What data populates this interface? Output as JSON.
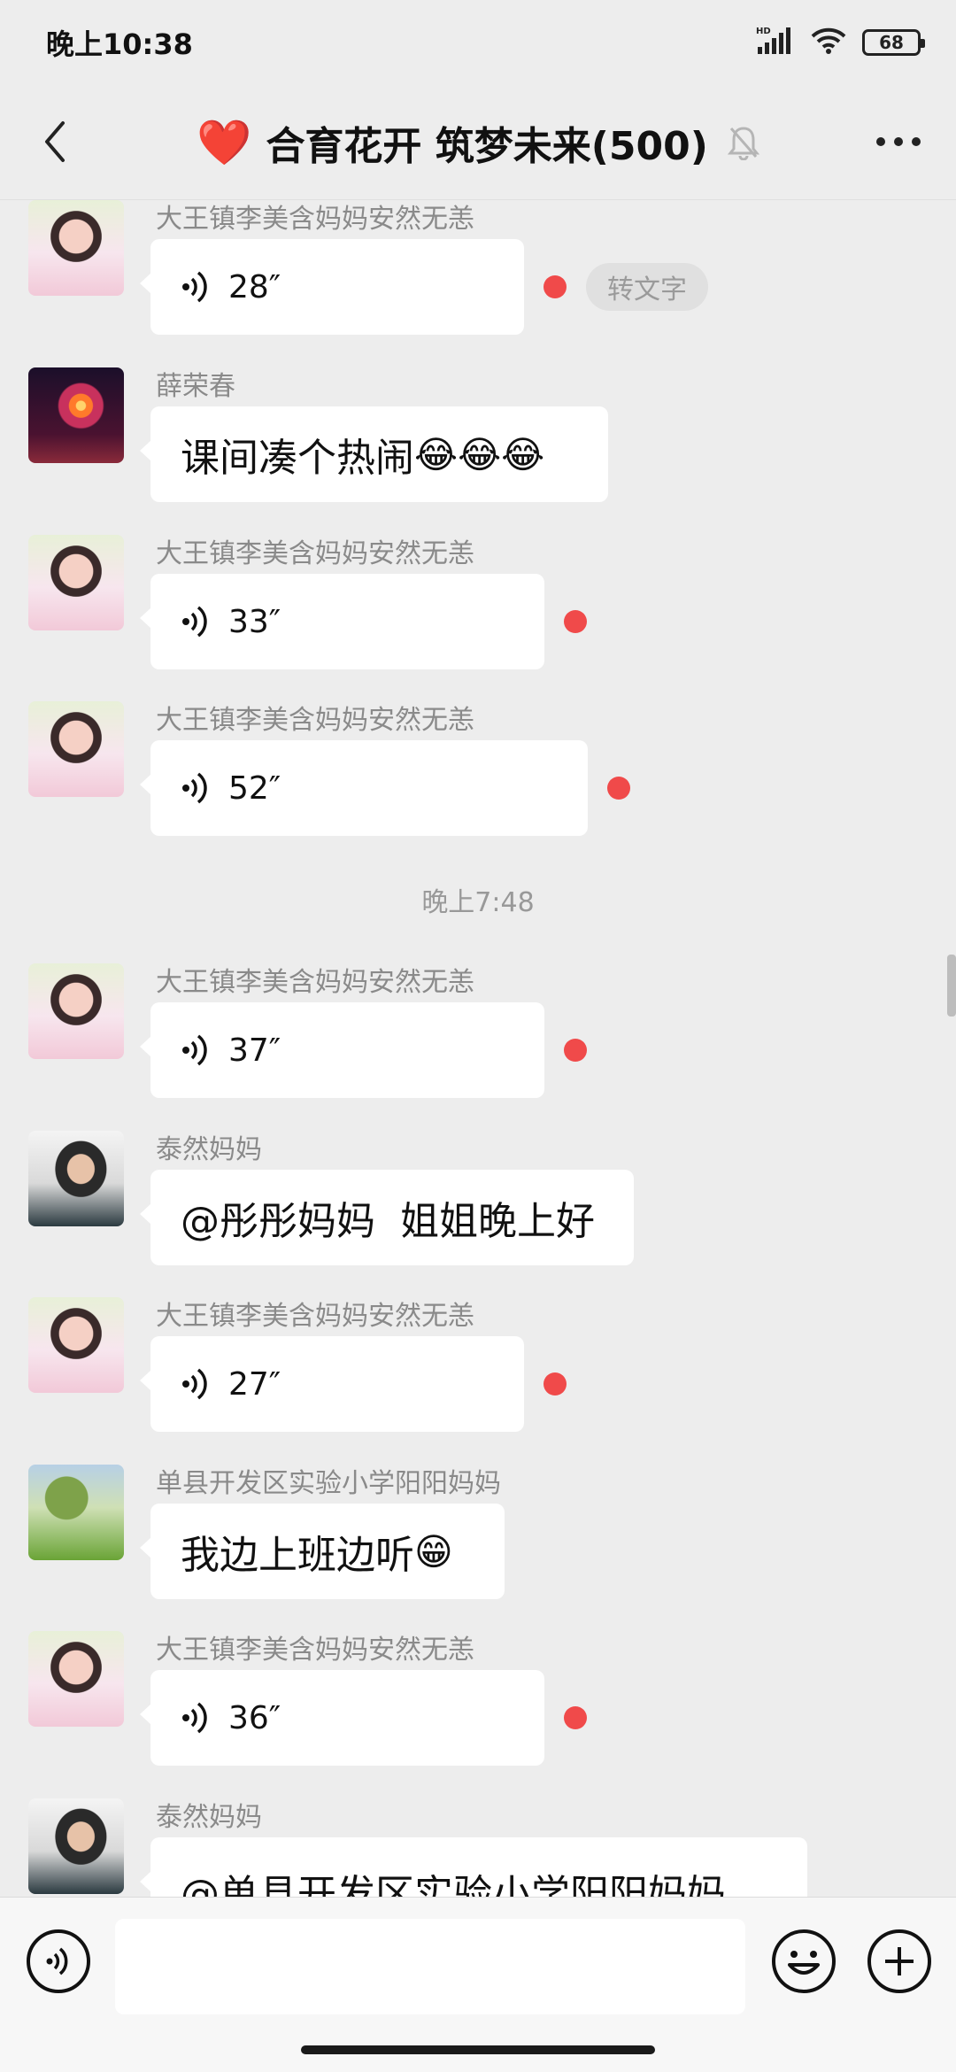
{
  "status_bar": {
    "time": "晚上10:38",
    "battery": "68",
    "network": "HD"
  },
  "header": {
    "title_emoji": "❤️",
    "title": "合育花开 筑梦未来(500)"
  },
  "messages": [
    {
      "sender": "大王镇李美含妈妈安然无恙",
      "type": "voice",
      "duration": "28″",
      "to_text": "转文字"
    },
    {
      "sender": "薛荣春",
      "type": "text",
      "text": "课间凑个热闹",
      "emojis": "😂😂😂"
    },
    {
      "sender": "大王镇李美含妈妈安然无恙",
      "type": "voice",
      "duration": "33″"
    },
    {
      "sender": "大王镇李美含妈妈安然无恙",
      "type": "voice",
      "duration": "52″"
    },
    {
      "sender": "大王镇李美含妈妈安然无恙",
      "type": "voice",
      "duration": "37″"
    },
    {
      "sender": "泰然妈妈",
      "type": "text",
      "text": "@彤彤妈妈  姐姐晚上好"
    },
    {
      "sender": "大王镇李美含妈妈安然无恙",
      "type": "voice",
      "duration": "27″"
    },
    {
      "sender": "单县开发区实验小学阳阳妈妈",
      "type": "text",
      "text": "我边上班边听",
      "emojis": "😁"
    },
    {
      "sender": "大王镇李美含妈妈安然无恙",
      "type": "voice",
      "duration": "36″"
    },
    {
      "sender": "泰然妈妈",
      "type": "text",
      "text": "@单县开发区实验小学阳阳妈妈"
    }
  ],
  "timestamp": "晚上7:48",
  "input": {
    "value": "",
    "placeholder": ""
  },
  "icons": {
    "back": "back-arrow-icon",
    "more": "more-dots-icon",
    "mute": "mute-bell-icon",
    "voice": "voice-wave-icon",
    "emoji": "smiley-icon",
    "plus": "plus-circle-icon"
  },
  "colors": {
    "background": "#ededed",
    "bubble": "#ffffff",
    "unread": "#f04a4a",
    "sender": "#8a8a8a"
  }
}
